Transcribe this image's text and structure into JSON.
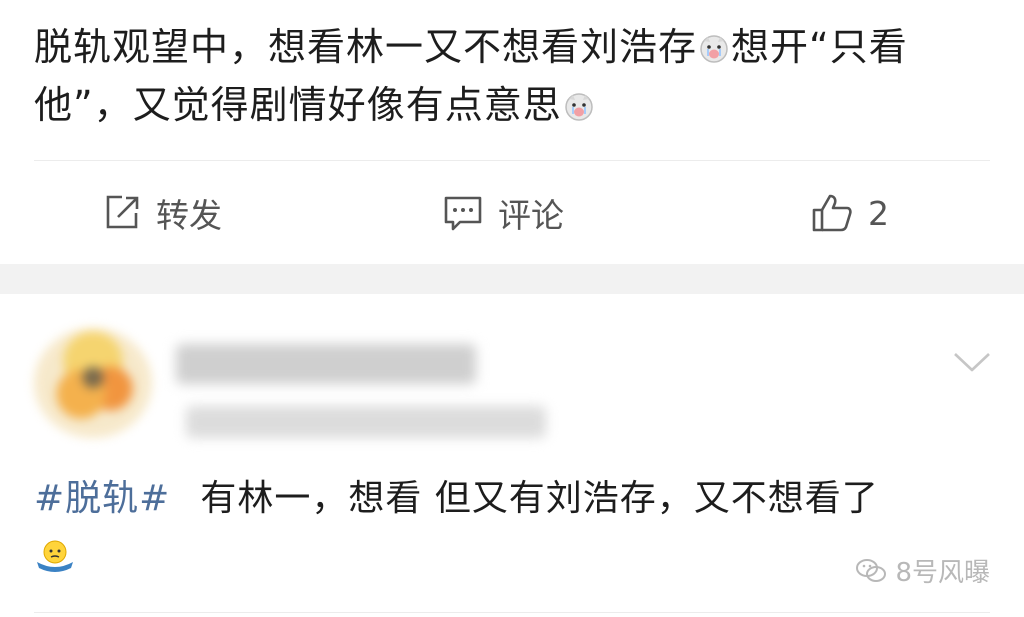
{
  "post": {
    "text_part1": "脱轨观望中，想看林一又不想看刘浩存",
    "text_part2": "想开“只看他”，又觉得剧情好像有点意思"
  },
  "actions": {
    "repost_label": "转发",
    "comment_label": "评论",
    "like_count": "2"
  },
  "comment": {
    "hashtag": "#脱轨#",
    "text": "有林一，想看 但又有刘浩存，又不想看了"
  },
  "watermark": {
    "text": "8号风曝"
  }
}
